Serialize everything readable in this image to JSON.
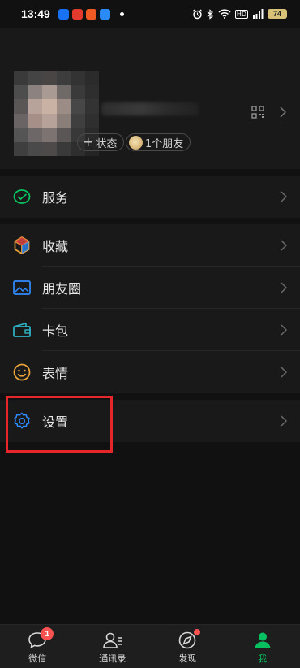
{
  "status_bar": {
    "time": "13:49",
    "battery": "74",
    "network": "HD",
    "signal": "5G"
  },
  "profile": {
    "status_label": "状态",
    "friends_label": "1个朋友"
  },
  "menu": {
    "services": "服务",
    "favorites": "收藏",
    "moments": "朋友圈",
    "cards": "卡包",
    "stickers": "表情",
    "settings": "设置"
  },
  "tabs": {
    "chats": "微信",
    "chats_badge": "1",
    "contacts": "通讯录",
    "discover": "发现",
    "me": "我"
  },
  "colors": {
    "accent_green": "#07c160",
    "badge_red": "#fa5151",
    "highlight_red": "#e6262b",
    "icon_blue": "#2f8cff",
    "icon_orange": "#e9a33a"
  }
}
